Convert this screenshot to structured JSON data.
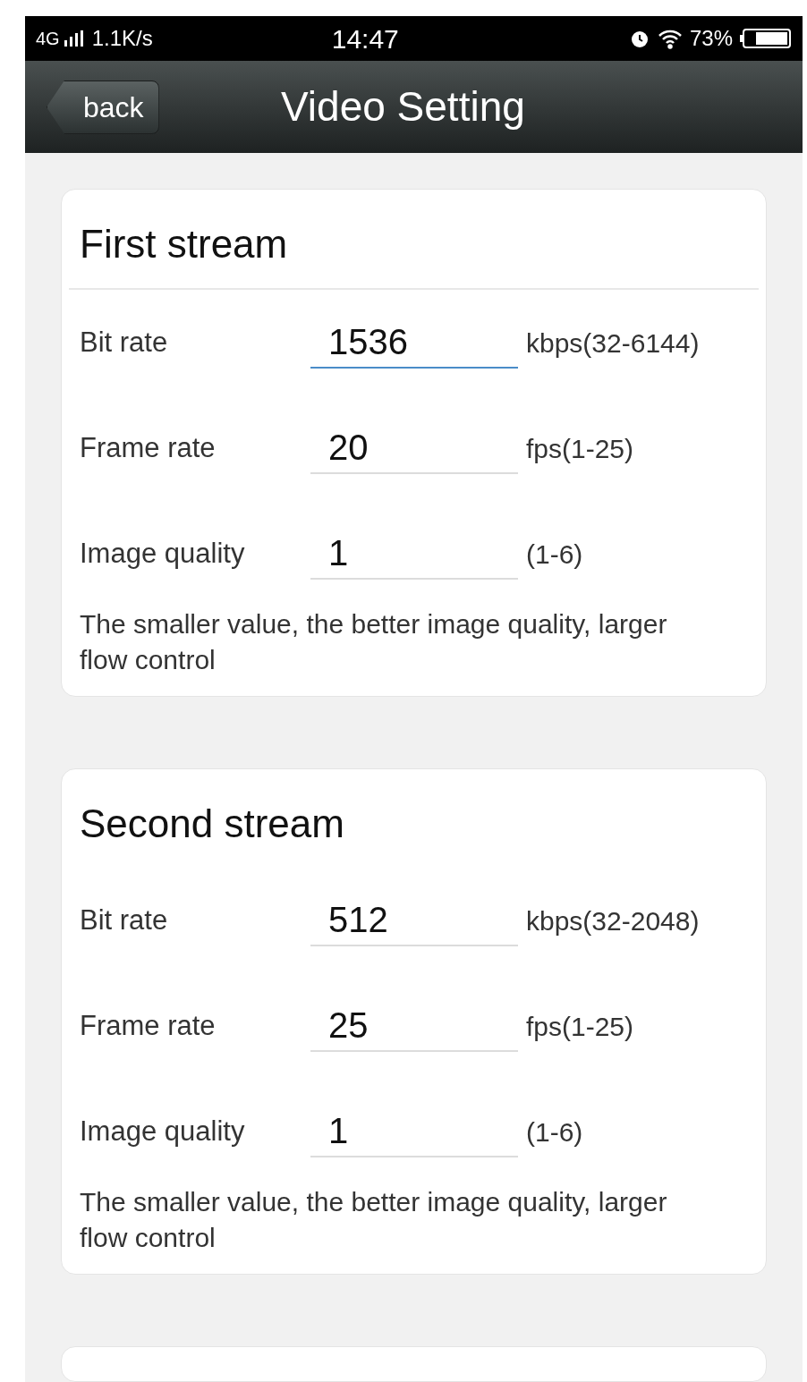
{
  "status_bar": {
    "network": "4G",
    "speed": "1.1K/s",
    "time": "14:47",
    "battery": "73%"
  },
  "header": {
    "back": "back",
    "title": "Video Setting"
  },
  "cards": [
    {
      "title": "First stream",
      "title_divider": true,
      "rows": [
        {
          "label": "Bit rate",
          "value": "1536",
          "unit": "kbps(32-6144)",
          "focused": true
        },
        {
          "label": "Frame rate",
          "value": "20",
          "unit": "fps(1-25)",
          "focused": false
        },
        {
          "label": "Image quality",
          "value": "1",
          "unit": "(1-6)",
          "focused": false
        }
      ],
      "note": "The smaller value, the better image quality, larger flow control"
    },
    {
      "title": "Second stream",
      "title_divider": false,
      "rows": [
        {
          "label": "Bit rate",
          "value": "512",
          "unit": "kbps(32-2048)",
          "focused": false
        },
        {
          "label": "Frame rate",
          "value": "25",
          "unit": "fps(1-25)",
          "focused": false
        },
        {
          "label": "Image quality",
          "value": "1",
          "unit": "(1-6)",
          "focused": false
        }
      ],
      "note": "The smaller value, the better image quality, larger flow control"
    }
  ]
}
